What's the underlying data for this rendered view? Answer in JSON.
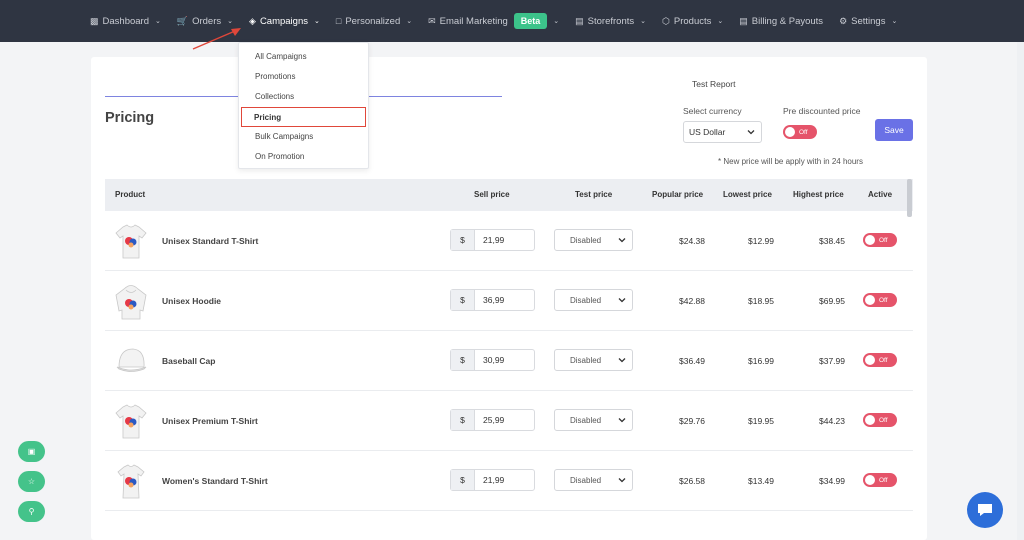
{
  "nav": {
    "items": [
      {
        "label": "Dashboard",
        "icon": "bar-chart-icon"
      },
      {
        "label": "Orders",
        "icon": "cart-icon"
      },
      {
        "label": "Campaigns",
        "icon": "campaign-icon"
      },
      {
        "label": "Personalized",
        "icon": "personalized-icon"
      },
      {
        "label": "Email Marketing",
        "icon": "mail-icon"
      },
      {
        "label": "Storefronts",
        "icon": "store-icon"
      },
      {
        "label": "Products",
        "icon": "box-icon"
      },
      {
        "label": "Billing & Payouts",
        "icon": "billing-icon"
      },
      {
        "label": "Settings",
        "icon": "gear-icon"
      }
    ],
    "beta_label": "Beta"
  },
  "campaigns_menu": {
    "items": [
      "All Campaigns",
      "Promotions",
      "Collections",
      "Pricing",
      "Bulk Campaigns",
      "On Promotion"
    ],
    "selected": "Pricing"
  },
  "page": {
    "tab_report": "Test Report",
    "title": "Pricing",
    "currency_label": "Select currency",
    "currency_value": "US Dollar",
    "prediscount_label": "Pre discounted price",
    "prediscount_toggle": "Off",
    "save_label": "Save",
    "note": "* New price will be apply with in 24 hours"
  },
  "table": {
    "headers": {
      "product": "Product",
      "sell_price": "Sell price",
      "test_price": "Test price",
      "popular_price": "Popular price",
      "lowest_price": "Lowest price",
      "highest_price": "Highest price",
      "active": "Active"
    },
    "rows": [
      {
        "name": "Unisex Standard T-Shirt",
        "currency": "$",
        "sell": "21,99",
        "test": "Disabled",
        "popular": "$24.38",
        "lowest": "$12.99",
        "highest": "$38.45",
        "active": "Off",
        "thumb": "tshirt"
      },
      {
        "name": "Unisex Hoodie",
        "currency": "$",
        "sell": "36,99",
        "test": "Disabled",
        "popular": "$42.88",
        "lowest": "$18.95",
        "highest": "$69.95",
        "active": "Off",
        "thumb": "hoodie"
      },
      {
        "name": "Baseball Cap",
        "currency": "$",
        "sell": "30,99",
        "test": "Disabled",
        "popular": "$36.49",
        "lowest": "$16.99",
        "highest": "$37.99",
        "active": "Off",
        "thumb": "cap"
      },
      {
        "name": "Unisex Premium T-Shirt",
        "currency": "$",
        "sell": "25,99",
        "test": "Disabled",
        "popular": "$29.76",
        "lowest": "$19.95",
        "highest": "$44.23",
        "active": "Off",
        "thumb": "tshirt"
      },
      {
        "name": "Women's Standard T-Shirt",
        "currency": "$",
        "sell": "21,99",
        "test": "Disabled",
        "popular": "$26.58",
        "lowest": "$13.49",
        "highest": "$34.99",
        "active": "Off",
        "thumb": "tshirt-women"
      }
    ]
  },
  "colors": {
    "nav_bg": "#2f3542",
    "accent": "#6a71e6",
    "toggle_off": "#e5546a",
    "beta": "#3cc38a",
    "highlight_box": "#e0473a",
    "fab": "#44c38a",
    "chat": "#2d6ed9"
  }
}
